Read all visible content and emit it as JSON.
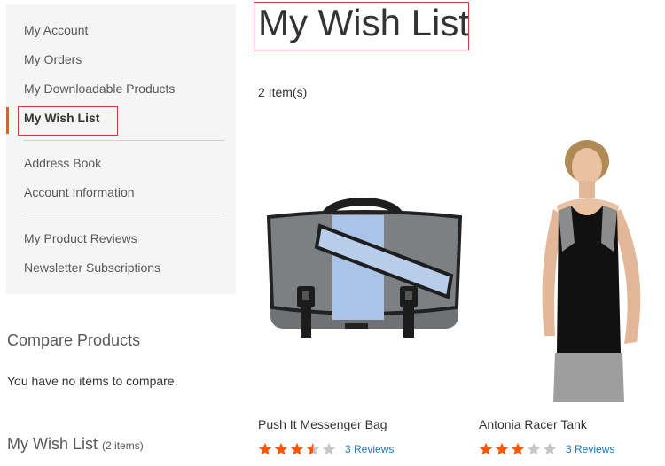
{
  "sidebar": {
    "items": [
      {
        "label": "My Account"
      },
      {
        "label": "My Orders"
      },
      {
        "label": "My Downloadable Products"
      },
      {
        "label": "My Wish List",
        "current": true
      },
      {
        "label": "Address Book"
      },
      {
        "label": "Account Information"
      },
      {
        "label": "My Product Reviews"
      },
      {
        "label": "Newsletter Subscriptions"
      }
    ],
    "accent_color": "#ff5501"
  },
  "compare": {
    "title": "Compare Products",
    "empty_text": "You have no items to compare."
  },
  "wishlist_block": {
    "title": "My Wish List",
    "count": "(2 items)"
  },
  "main": {
    "title": "My Wish List",
    "items_count": "2 Item(s)",
    "products": [
      {
        "name": "Push It Messenger Bag",
        "rating_stars": 3.5,
        "reviews": "3 Reviews",
        "image": "messenger-bag"
      },
      {
        "name": "Antonia Racer Tank",
        "rating_stars": 3,
        "reviews": "3 Reviews",
        "image": "woman-racer-tank"
      }
    ]
  },
  "colors": {
    "star_filled": "#ff5501",
    "star_empty": "#c7c7c7",
    "link": "#1979c3",
    "highlight_box": "#d0393e"
  }
}
